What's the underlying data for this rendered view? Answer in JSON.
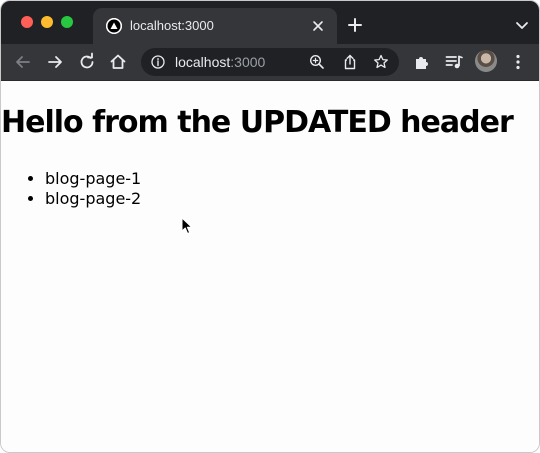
{
  "browser": {
    "tab": {
      "title": "localhost:3000",
      "favicon": "nextjs-triangle-icon"
    },
    "omnibox": {
      "host": "localhost",
      "port": ":3000"
    },
    "icons": {
      "window_controls": [
        "close",
        "minimize",
        "zoom"
      ],
      "tab_close": "close-icon",
      "new_tab": "plus-icon",
      "tab_search": "chevron-down-icon",
      "back": "back-arrow-icon",
      "forward": "forward-arrow-icon",
      "reload": "reload-icon",
      "home": "home-icon",
      "site_info": "info-icon",
      "zoom": "zoom-icon",
      "share": "share-icon",
      "bookmark": "star-icon",
      "extensions": "puzzle-icon",
      "media": "media-queue-icon",
      "profile": "avatar",
      "menu": "kebab-menu-icon"
    },
    "colors": {
      "tabstrip": "#202124",
      "toolbar": "#35363a",
      "close": "#ff5f57",
      "minimize": "#febc2e",
      "zoom": "#28c840"
    }
  },
  "page": {
    "heading": "Hello from the UPDATED header",
    "links": [
      "blog-page-1",
      "blog-page-2"
    ]
  }
}
